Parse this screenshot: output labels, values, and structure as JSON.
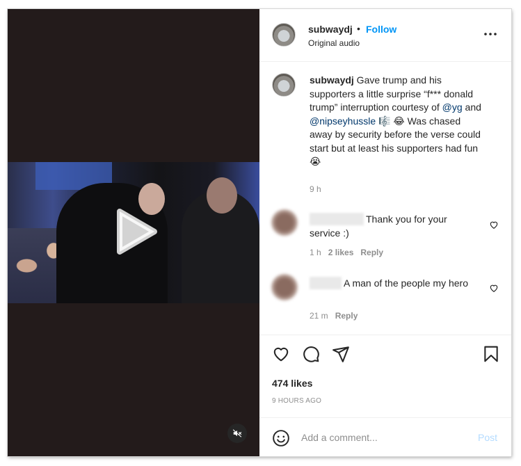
{
  "post": {
    "username": "subwaydj",
    "follow_label": "Follow",
    "separator": "•",
    "audio_label": "Original audio"
  },
  "caption": {
    "username": "subwaydj",
    "text_1": " Gave trump and his supporters a little surprise “f*** donald trump” interruption courtesy of ",
    "mention_1": "@yg",
    "text_2": " and ",
    "mention_2": "@nipseyhussle",
    "text_3": " 🎼 😂 Was chased away by security before the verse could start but at least his supporters had fun 😭",
    "time": "9 h"
  },
  "comments": [
    {
      "text": "Thank you for your service :)",
      "time": "1 h",
      "likes": "2 likes",
      "reply_label": "Reply"
    },
    {
      "text": "A man of the people my hero",
      "time": "21 m",
      "reply_label": "Reply"
    }
  ],
  "actions": {
    "icons": [
      "heart-icon",
      "comment-icon",
      "share-icon",
      "bookmark-icon"
    ],
    "likes_count": "474 likes",
    "time_ago": "9 HOURS AGO"
  },
  "add_comment": {
    "placeholder": "Add a comment...",
    "post_label": "Post"
  },
  "colors": {
    "accent": "#0095f6",
    "mention": "#00376b",
    "muted": "#8e8e8e",
    "post_disabled": "#b3dbff",
    "media_bg": "#231b1b"
  }
}
